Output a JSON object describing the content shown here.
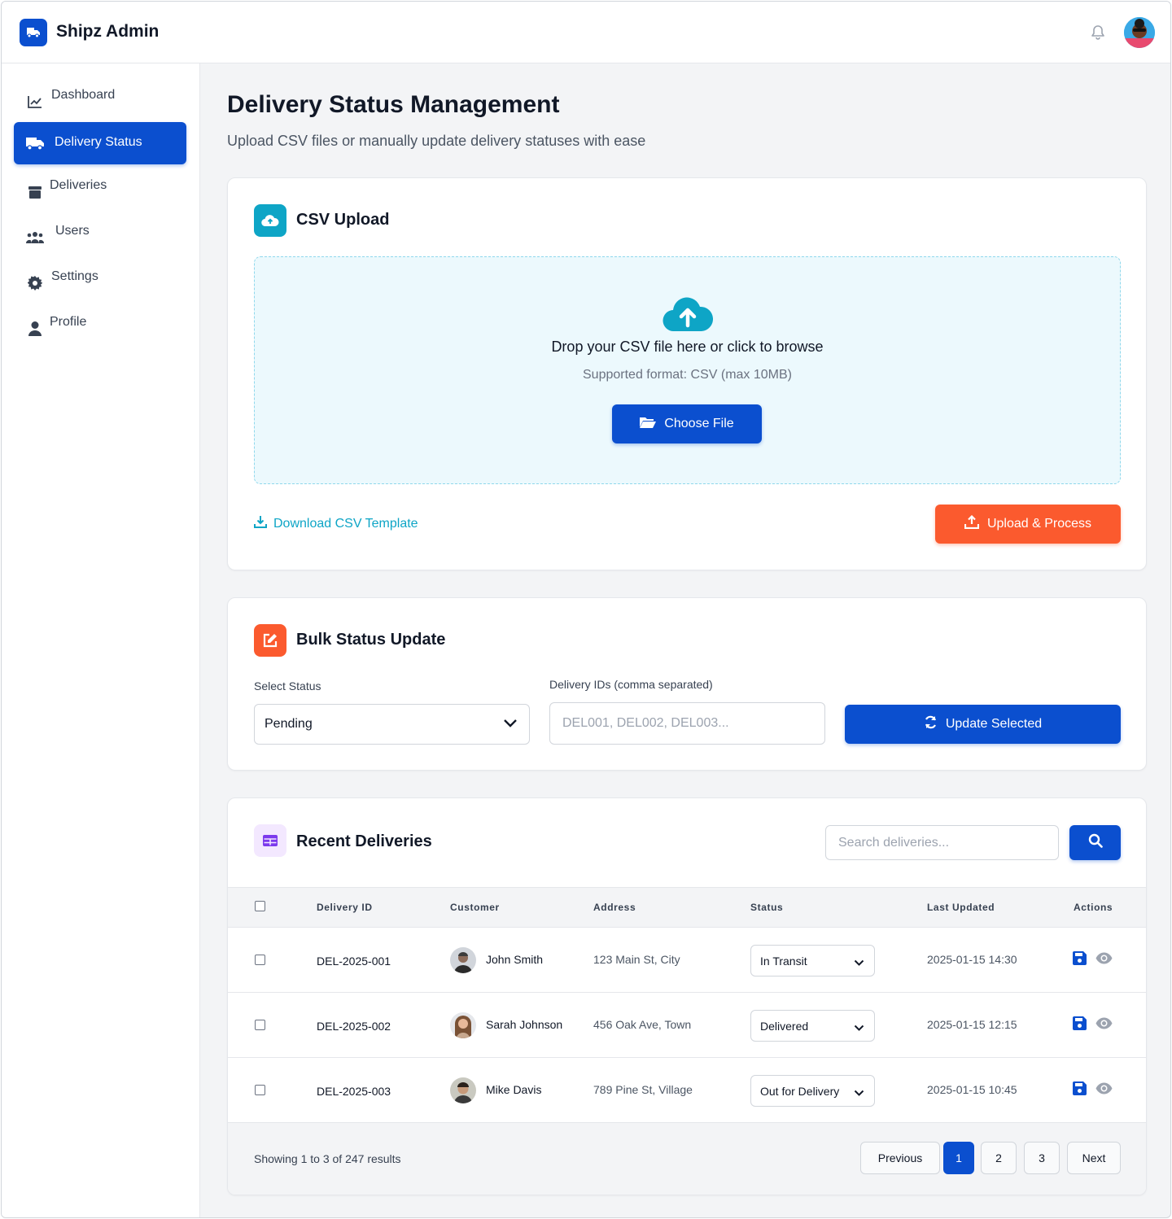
{
  "app": {
    "title": "Shipz Admin"
  },
  "sidebar": {
    "items": [
      {
        "label": "Dashboard",
        "icon": "chart-line-icon"
      },
      {
        "label": "Delivery Status",
        "icon": "truck-icon",
        "active": true
      },
      {
        "label": "Deliveries",
        "icon": "box-icon"
      },
      {
        "label": "Users",
        "icon": "users-icon"
      },
      {
        "label": "Settings",
        "icon": "gear-icon"
      },
      {
        "label": "Profile",
        "icon": "user-icon"
      }
    ]
  },
  "page": {
    "title": "Delivery Status Management",
    "subtitle": "Upload CSV files or manually update delivery statuses with ease"
  },
  "csv_upload": {
    "title": "CSV Upload",
    "drop_title": "Drop your CSV file here or click to browse",
    "drop_sub": "Supported format: CSV (max 10MB)",
    "choose_label": "Choose File",
    "download_label": "Download CSV Template",
    "upload_label": "Upload & Process"
  },
  "bulk": {
    "title": "Bulk Status Update",
    "status_label": "Select Status",
    "status_value": "Pending",
    "ids_label": "Delivery IDs (comma separated)",
    "ids_placeholder": "DEL001, DEL002, DEL003...",
    "update_label": "Update Selected"
  },
  "recent": {
    "title": "Recent Deliveries",
    "search_placeholder": "Search deliveries...",
    "columns": [
      "Delivery ID",
      "Customer",
      "Address",
      "Status",
      "Last Updated",
      "Actions"
    ],
    "rows": [
      {
        "id": "DEL-2025-001",
        "customer": "John Smith",
        "address": "123 Main St, City",
        "status": "In Transit",
        "updated": "2025-01-15 14:30"
      },
      {
        "id": "DEL-2025-002",
        "customer": "Sarah Johnson",
        "address": "456 Oak Ave, Town",
        "status": "Delivered",
        "updated": "2025-01-15 12:15"
      },
      {
        "id": "DEL-2025-003",
        "customer": "Mike Davis",
        "address": "789 Pine St, Village",
        "status": "Out for Delivery",
        "updated": "2025-01-15 10:45"
      }
    ],
    "footer_text": "Showing 1 to 3 of 247 results",
    "pagination": {
      "prev": "Previous",
      "pages": [
        "1",
        "2",
        "3"
      ],
      "next": "Next",
      "current": "1"
    }
  },
  "colors": {
    "primary": "#0b4fcf",
    "accent_orange": "#fb5a2e",
    "accent_cyan": "#0ea5c6",
    "accent_purple": "#7c3aed"
  }
}
